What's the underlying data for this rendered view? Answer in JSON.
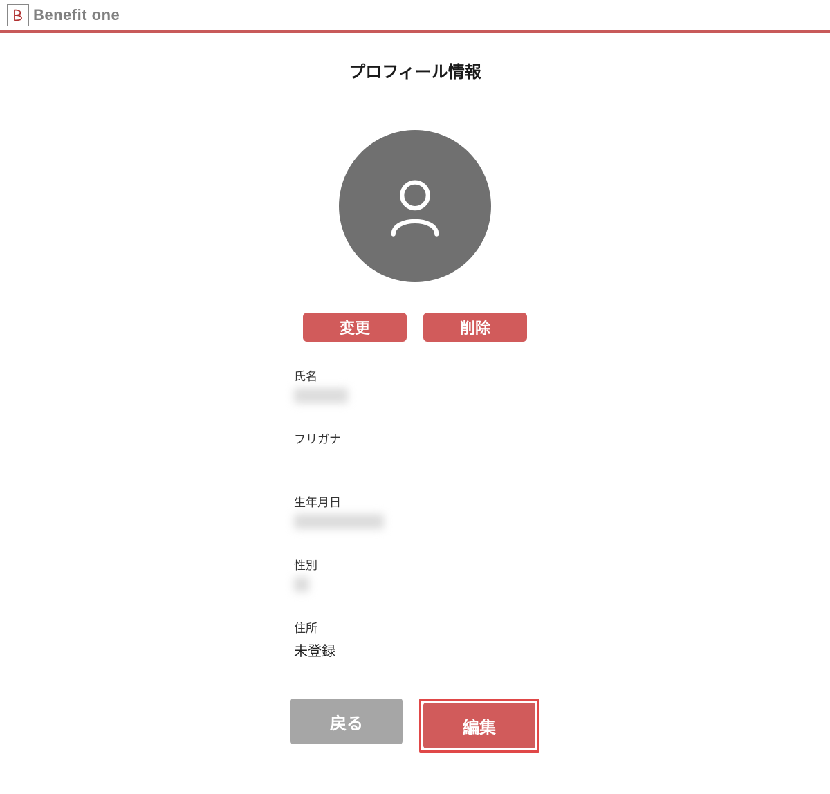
{
  "header": {
    "brand": "Benefit one"
  },
  "page": {
    "title": "プロフィール情報"
  },
  "avatar_actions": {
    "change": "変更",
    "delete": "削除"
  },
  "fields": {
    "name": {
      "label": "氏名",
      "value": ""
    },
    "furigana": {
      "label": "フリガナ",
      "value": ""
    },
    "dob": {
      "label": "生年月日",
      "value": ""
    },
    "gender": {
      "label": "性別",
      "value": ""
    },
    "address": {
      "label": "住所",
      "value": "未登録"
    }
  },
  "bottom_actions": {
    "back": "戻る",
    "edit": "編集"
  }
}
